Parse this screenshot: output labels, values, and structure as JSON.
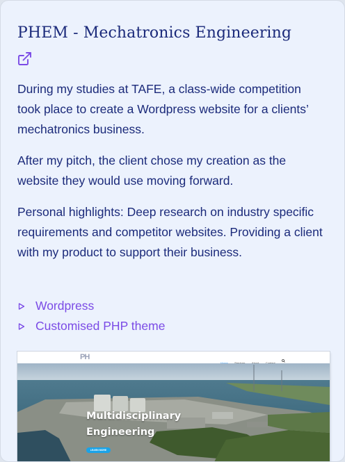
{
  "project": {
    "title": "PHEM - Mechatronics Engineering",
    "link_icon": "external-link-icon",
    "paragraphs": [
      "During my studies at TAFE, a class-wide competition took place to create a Wordpress website for a clients’ mechatronics business.",
      "After my pitch, the client chose my creation as the website they would use moving forward.",
      "Personal highlights: Deep research on industry specific requirements and competitor websites. Providing a client with my product to support their business."
    ],
    "tags": [
      "Wordpress",
      "Customised PHP theme"
    ],
    "tag_icon": "triangle-right-icon"
  },
  "screenshot": {
    "logo": "PH",
    "nav": [
      "Home",
      "Services",
      "About",
      "Contact"
    ],
    "hero_title_line1": "Multidisciplinary",
    "hero_title_line2": "Engineering",
    "hero_button": "LEARN MORE"
  },
  "colors": {
    "card_bg": "#ecf2fd",
    "text": "#1b2a7a",
    "accent": "#7b4be6",
    "hero_button": "#1aa3e8"
  }
}
